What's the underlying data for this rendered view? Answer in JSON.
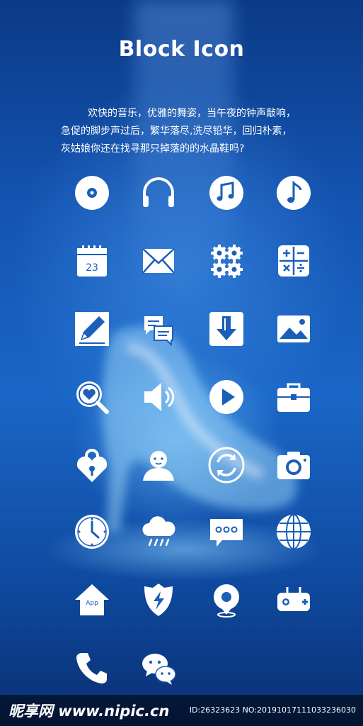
{
  "title": "Block Icon",
  "poem": {
    "line1": "欢快的音乐，优雅的舞姿，当午夜的钟声敲响，",
    "line2": "急促的脚步声过后，繁华落尽,洗尽铅华，回归朴素，",
    "line3": "灰姑娘你还在找寻那只掉落的的水晶鞋吗?"
  },
  "icons": {
    "calendar_date": "23",
    "home_label": "App"
  },
  "footer": {
    "logo": "昵享网 www.nipic.cn",
    "id": "ID:26323623 NO:20191017111033236030"
  },
  "colors": {
    "background_top": "#0b3a86",
    "background_mid": "#1a66c6",
    "icon": "#ffffff"
  }
}
